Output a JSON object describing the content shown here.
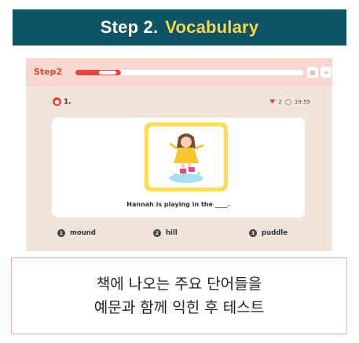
{
  "banner": {
    "step": "Step 2.",
    "title": "Vocabulary",
    "accent_color": "#f7d84a",
    "bg_color": "#0f5366"
  },
  "app": {
    "step_label": "Step2",
    "progress": 0.2,
    "buttons": [
      {
        "icon": "grid-icon",
        "glyph": "▦"
      },
      {
        "icon": "list-icon",
        "glyph": "≡"
      }
    ],
    "question_number": "1.",
    "hearts": "2",
    "time": "19:59",
    "sentence": "Hannah is playing in the ____.",
    "options": [
      {
        "num": "1",
        "label": "mound"
      },
      {
        "num": "2",
        "label": "hill"
      },
      {
        "num": "3",
        "label": "puddle"
      }
    ]
  },
  "caption": {
    "line1": "책에 나오는 주요 단어들을",
    "line2": "예문과 함께 익힌 후 테스트"
  }
}
